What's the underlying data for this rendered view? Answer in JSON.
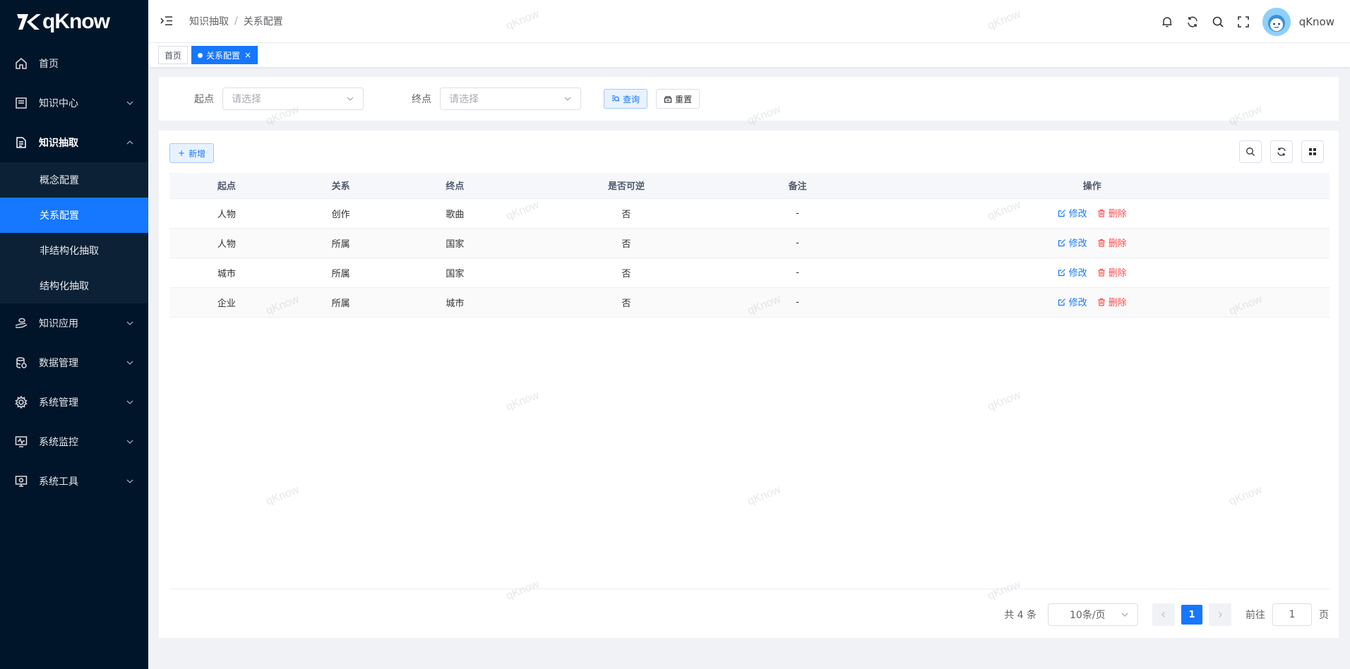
{
  "app": {
    "logo_text": "qKnow"
  },
  "sidebar": {
    "items": [
      {
        "label": "首页",
        "icon": "home-icon"
      },
      {
        "label": "知识中心",
        "icon": "book-icon"
      },
      {
        "label": "知识抽取",
        "icon": "document-icon",
        "open": true,
        "children": [
          {
            "label": "概念配置"
          },
          {
            "label": "关系配置",
            "active": true
          },
          {
            "label": "非结构化抽取"
          },
          {
            "label": "结构化抽取"
          }
        ]
      },
      {
        "label": "知识应用",
        "icon": "hand-icon"
      },
      {
        "label": "数据管理",
        "icon": "database-icon"
      },
      {
        "label": "系统管理",
        "icon": "gear-icon"
      },
      {
        "label": "系统监控",
        "icon": "monitor-icon"
      },
      {
        "label": "系统工具",
        "icon": "tools-icon"
      }
    ]
  },
  "header": {
    "breadcrumb": [
      "知识抽取",
      "关系配置"
    ],
    "breadcrumb_sep": "/",
    "user_name": "qKnow"
  },
  "tags": {
    "home": "首页",
    "current": "关系配置",
    "close": "×"
  },
  "search": {
    "start_label": "起点",
    "start_placeholder": "请选择",
    "end_label": "终点",
    "end_placeholder": "请选择",
    "query_button": "查询",
    "reset_button": "重置"
  },
  "table": {
    "add_button": "新增",
    "add_prefix": "+",
    "columns": [
      "起点",
      "关系",
      "终点",
      "是否可逆",
      "备注",
      "操作"
    ],
    "rows": [
      {
        "start": "人物",
        "relation": "创作",
        "end": "歌曲",
        "reversible": "否",
        "remark": "-"
      },
      {
        "start": "人物",
        "relation": "所属",
        "end": "国家",
        "reversible": "否",
        "remark": "-"
      },
      {
        "start": "城市",
        "relation": "所属",
        "end": "国家",
        "reversible": "否",
        "remark": "-"
      },
      {
        "start": "企业",
        "relation": "所属",
        "end": "城市",
        "reversible": "否",
        "remark": "-"
      }
    ],
    "edit_label": "修改",
    "delete_label": "删除"
  },
  "pagination": {
    "total_text": "共 4 条",
    "page_size": "10条/页",
    "current_page": "1",
    "goto_label": "前往",
    "goto_value": "1",
    "page_suffix": "页"
  },
  "watermark": "qKnow",
  "colors": {
    "primary": "#1677ff",
    "sidebar_bg": "#001529",
    "danger": "#ff4d4f"
  }
}
